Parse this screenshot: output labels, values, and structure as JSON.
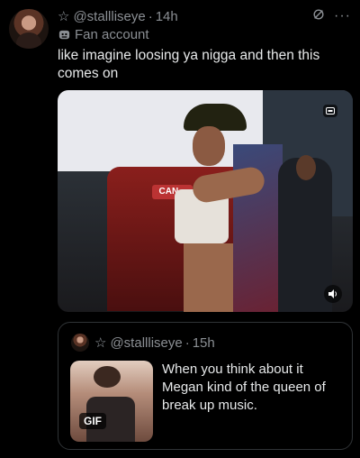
{
  "post": {
    "handle": "@stallliseye",
    "time": "14h",
    "label": "Fan account",
    "text": "like imagine loosing ya nigga and then this comes on",
    "star_icon": "star-outline-icon",
    "grok_icon": "grok-icon",
    "more_icon": "more-icon"
  },
  "media": {
    "car_sign": "CAN...",
    "alt_icon": "alt-text-icon",
    "sound_icon": "sound-icon"
  },
  "quote": {
    "handle": "@stallliseye",
    "time": "15h",
    "text": "When you think about it Megan kind of the queen of break up music.",
    "badge": "GIF"
  }
}
